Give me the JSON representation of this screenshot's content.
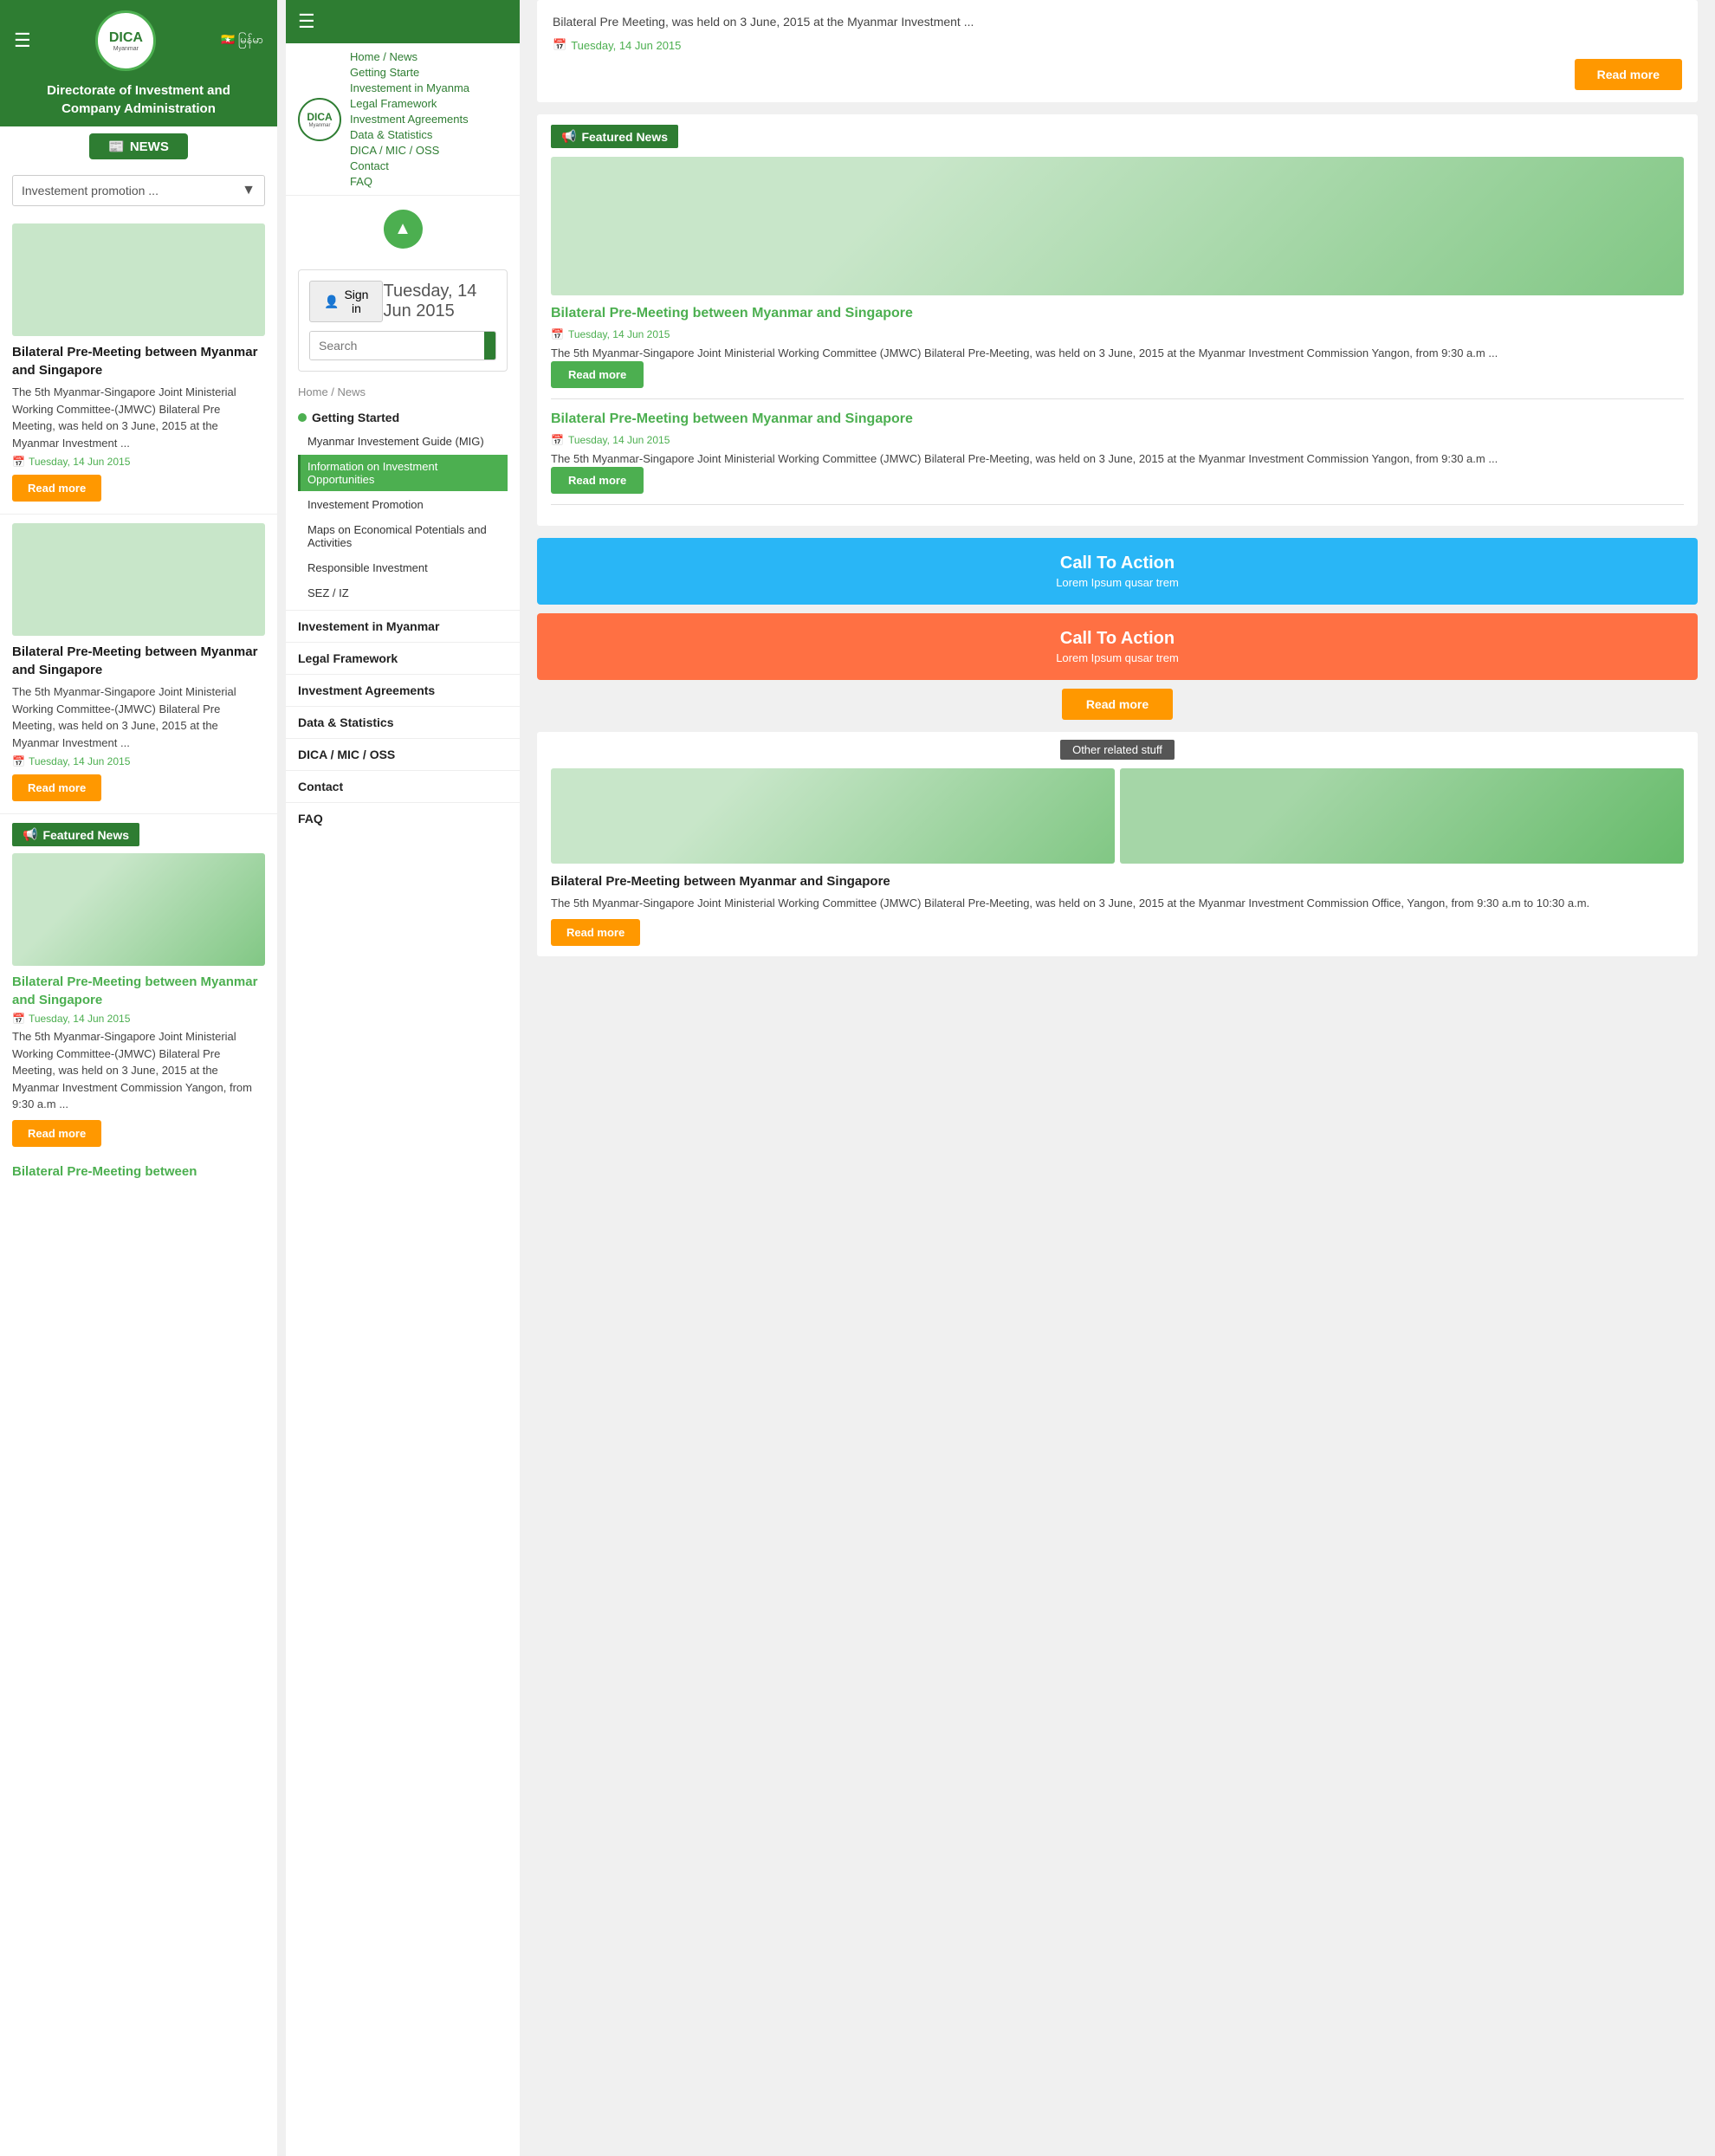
{
  "app": {
    "title": "DICA - Directorate of Investment and Company Administration"
  },
  "left": {
    "logo_text": "DICA",
    "logo_sub": "Myanmar",
    "org_title": "Directorate of Investment and\nCompany Administration",
    "news_label": "NEWS",
    "dropdown_placeholder": "Investement promotion ...",
    "news_cards": [
      {
        "title": "Bilateral Pre-Meeting between Myanmar and Singapore",
        "body": "The 5th Myanmar-Singapore Joint Ministerial Working Committee-(JMWC) Bilateral Pre Meeting, was held on 3 June, 2015 at the Myanmar Investment ...",
        "date": "Tuesday, 14 Jun 2015",
        "read_more": "Read more"
      },
      {
        "title": "Bilateral Pre-Meeting between Myanmar and Singapore",
        "body": "The 5th Myanmar-Singapore Joint Ministerial Working Committee-(JMWC) Bilateral Pre Meeting, was held on 3 June, 2015 at the Myanmar Investment ...",
        "date": "Tuesday, 14 Jun 2015",
        "read_more": "Read more"
      }
    ],
    "featured_news": {
      "label": "Featured News",
      "title": "Bilateral Pre-Meeting between Myanmar and Singapore",
      "date": "Tuesday, 14 Jun 2015",
      "body": "The 5th Myanmar-Singapore Joint Ministerial Working Committee-(JMWC) Bilateral Pre Meeting, was held on 3 June, 2015 at the Myanmar Investment Commission Yangon, from 9:30 a.m ...",
      "read_more": "Read more"
    },
    "bilateral_more": "Bilateral Pre-Meeting between"
  },
  "middle": {
    "signin_label": "Sign in",
    "search_placeholder": "Search",
    "close_label": "×",
    "breadcrumb": "Home / News",
    "getting_started": "Getting Started",
    "sub_items": [
      {
        "label": "Myanmar Investement Guide (MIG)",
        "active": false
      },
      {
        "label": "Information on Investment Opportunities",
        "active": true
      },
      {
        "label": "Investement Promotion",
        "active": false
      },
      {
        "label": "Maps on Economical Potentials and Activities",
        "active": false
      },
      {
        "label": "Responsible Investment",
        "active": false
      },
      {
        "label": "SEZ / IZ",
        "active": false
      }
    ],
    "main_nav_items": [
      {
        "label": "Investement in Myanmar"
      },
      {
        "label": "Legal Framework"
      },
      {
        "label": "Investment Agreements"
      },
      {
        "label": "Data & Statistics"
      },
      {
        "label": "DICA / MIC / OSS"
      },
      {
        "label": "Contact"
      },
      {
        "label": "FAQ"
      }
    ],
    "nav_links": [
      {
        "label": "Home / News"
      },
      {
        "label": "Getting Starte"
      },
      {
        "label": "Investement in Myanma"
      },
      {
        "label": "Legal Framework"
      },
      {
        "label": "Investment Agreements"
      },
      {
        "label": "Data & Statistics"
      },
      {
        "label": "DICA / MIC / OSS"
      },
      {
        "label": "Contact"
      },
      {
        "label": "FAQ"
      }
    ],
    "scroll_up_label": "▲"
  },
  "right": {
    "top_article": {
      "body": "Bilateral Pre Meeting, was held on 3 June, 2015 at the Myanmar Investment ...",
      "date": "Tuesday, 14 Jun 2015",
      "read_more": "Read more"
    },
    "featured_news": {
      "label": "Featured News",
      "cards": [
        {
          "title": "Bilateral Pre-Meeting between Myanmar and Singapore",
          "date": "Tuesday, 14 Jun 2015",
          "body": "The 5th Myanmar-Singapore Joint Ministerial Working Committee (JMWC) Bilateral Pre-Meeting, was held on 3 June, 2015 at the Myanmar Investment Commission Yangon, from 9:30 a.m ...",
          "read_more": "Read more"
        },
        {
          "title": "Bilateral Pre-Meeting between Myanmar and Singapore",
          "date": "Tuesday, 14 Jun 2015",
          "body": "The 5th Myanmar-Singapore Joint Ministerial Working Committee (JMWC) Bilateral Pre-Meeting, was held on 3 June, 2015 at the Myanmar Investment Commission Yangon, from 9:30 a.m ...",
          "read_more": "Read more"
        }
      ]
    },
    "cta_blue": {
      "title": "Call To Action",
      "subtitle": "Lorem Ipsum qusar trem"
    },
    "cta_orange": {
      "title": "Call To Action",
      "subtitle": "Lorem Ipsum qusar trem"
    },
    "read_more_center": "Read more",
    "other_related": {
      "label": "Other related stuff",
      "title": "Bilateral Pre-Meeting between Myanmar and Singapore",
      "body": "The 5th Myanmar-Singapore Joint Ministerial Working Committee (JMWC) Bilateral Pre-Meeting, was held on 3 June, 2015 at the Myanmar Investment Commission Office, Yangon, from 9:30 a.m to 10:30 a.m.",
      "read_more": "Read more"
    }
  },
  "icons": {
    "hamburger": "☰",
    "calendar": "📅",
    "megaphone": "📢",
    "news": "📰",
    "search": "🔍",
    "user": "👤",
    "chevron_down": "▼",
    "scroll_up": "▲"
  }
}
